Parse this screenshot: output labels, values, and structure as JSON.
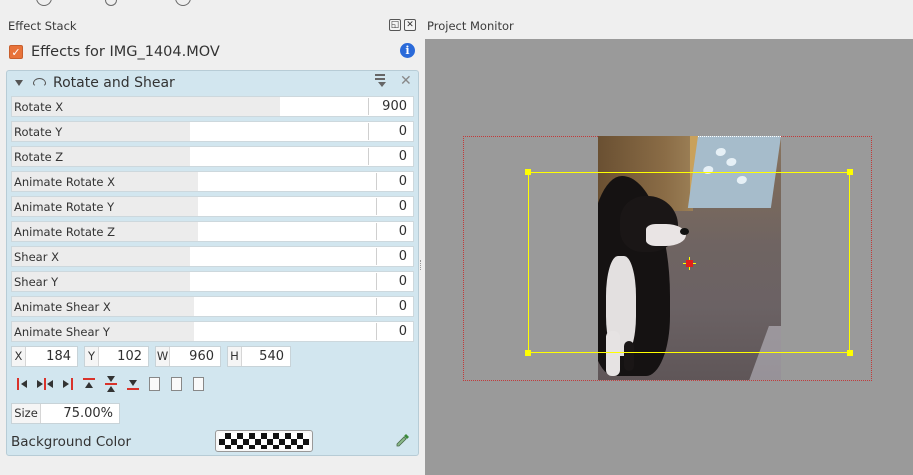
{
  "effect_stack": {
    "title": "Effect Stack",
    "float_icon": "float-icon",
    "close_icon": "close-icon",
    "clip_label": "Effects for IMG_1404.MOV",
    "clip_checked": true,
    "info_icon": "info-icon",
    "effect": {
      "name": "Rotate and Shear",
      "params": [
        {
          "label": "Rotate X",
          "value": "900",
          "fill": 1.0
        },
        {
          "label": "Rotate Y",
          "value": "0",
          "fill": 0.5
        },
        {
          "label": "Rotate Z",
          "value": "0",
          "fill": 0.5
        },
        {
          "label": "Animate Rotate X",
          "value": "0",
          "fill": 0.5
        },
        {
          "label": "Animate Rotate Y",
          "value": "0",
          "fill": 0.5
        },
        {
          "label": "Animate Rotate Z",
          "value": "0",
          "fill": 0.5
        },
        {
          "label": "Shear X",
          "value": "0",
          "fill": 0.5
        },
        {
          "label": "Shear Y",
          "value": "0",
          "fill": 0.5
        },
        {
          "label": "Animate Shear X",
          "value": "0",
          "fill": 0.5
        },
        {
          "label": "Animate Shear Y",
          "value": "0",
          "fill": 0.5
        }
      ],
      "geometry": [
        {
          "label": "X",
          "value": "184"
        },
        {
          "label": "Y",
          "value": "102"
        },
        {
          "label": "W",
          "value": "960"
        },
        {
          "label": "H",
          "value": "540"
        }
      ],
      "size_label": "Size",
      "size_value": "75.00%",
      "background_color_label": "Background Color"
    }
  },
  "project_monitor": {
    "title": "Project Monitor"
  },
  "colors": {
    "panel_bg": "#d2e6ef",
    "accent_orange": "#e8733a",
    "monitor_bg": "#9a9a9a",
    "selection_yellow": "#ffff00",
    "frame_red": "#c23a3a"
  }
}
